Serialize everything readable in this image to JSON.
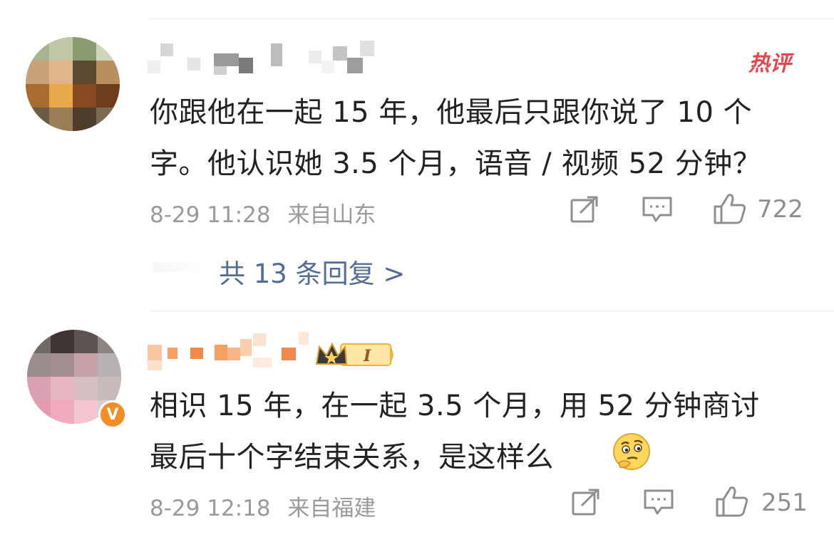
{
  "comments": [
    {
      "badge": "热评",
      "text_line1": "你跟他在一起 15 年，他最后只跟你说了 10 个",
      "text_line2": "字。他认识她 3.5 个月，语音 / 视频 52 分钟？",
      "date": "8-29 11:28",
      "location": "来自山东",
      "likes": "722",
      "replies_label": "共 13 条回复 >"
    },
    {
      "text_line1": "相识 15 年，在一起 3.5 个月，用 52 分钟商讨",
      "text_line2": "最后十个字结束关系，是这样么",
      "date": "8-29 12:18",
      "location": "来自福建",
      "likes": "251",
      "verified_mark": "V",
      "fan_badge_level": "I"
    }
  ],
  "colors": {
    "hot_badge": "#e2474b",
    "reply_link": "#536d95",
    "meta_text": "#9a9a9a",
    "verified": "#f38d24"
  },
  "icons": [
    "repost-icon",
    "comment-icon",
    "like-icon",
    "thinking-emoji-icon",
    "crown-fan-badge-icon"
  ]
}
